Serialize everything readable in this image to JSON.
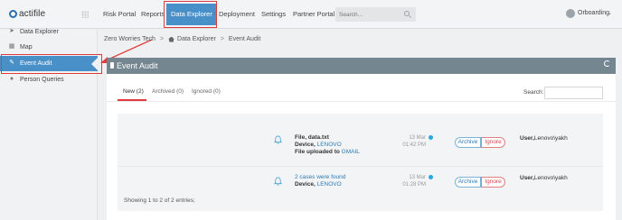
{
  "app": {
    "logo_text": "actifile"
  },
  "topnav": {
    "items": [
      "Risk Portal",
      "Reports",
      "Data Explorer",
      "Deployment",
      "Settings",
      "Partner Portal"
    ],
    "active": "Data Explorer",
    "search_placeholder": "Search...",
    "user": "Orboarding"
  },
  "sidebar": {
    "items": [
      {
        "label": "Data Explorer",
        "icon": "paper-plane-icon"
      },
      {
        "label": "Map",
        "icon": "map-icon"
      },
      {
        "label": "Event Audit",
        "icon": "edit-icon"
      },
      {
        "label": "Person Queries",
        "icon": "user-icon"
      }
    ],
    "active": "Event Audit"
  },
  "breadcrumb": {
    "root": "Zero Worries Tech",
    "section": "Data Explorer",
    "page": "Event Audit"
  },
  "panel": {
    "title": "Event Audit"
  },
  "tabs": {
    "new": "New (2)",
    "archived": "Archived (0)",
    "ignored": "Ignored (0)"
  },
  "search_label": "Search:",
  "events": [
    {
      "line1": "File, data.txt",
      "device_label": "Device,",
      "device": "LENOVO",
      "line3_prefix": "File uploaded to",
      "line3_link": "GMAIL",
      "date": "13 Mar",
      "time": "01:42 PM",
      "archive": "Archive",
      "ignore": "Ignore",
      "user_label": "User,",
      "user": "Lenovo\\yakh"
    },
    {
      "line1": "2 cases were found",
      "device_label": "Device,",
      "device": "LENOVO",
      "date": "13 Mar",
      "time": "01:28 PM",
      "archive": "Archive",
      "ignore": "Ignore",
      "user_label": "User,",
      "user": "Lenovo\\yakh"
    }
  ],
  "footer": "Showing 1 to 2 of 2 entries;",
  "colors": {
    "accent": "#4a90c8",
    "highlight": "#e03b3b",
    "panel_header": "#74868f",
    "link": "#2a7ab8",
    "unread_dot": "#29a8e0"
  }
}
